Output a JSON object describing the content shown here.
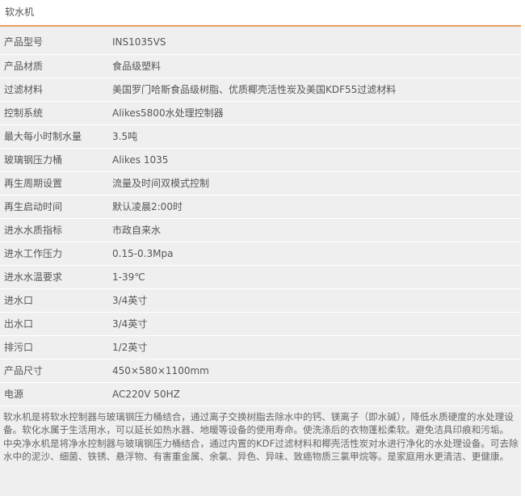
{
  "header": {
    "title": "软水机"
  },
  "specs": [
    {
      "label": "产品型号",
      "value": "INS1035VS"
    },
    {
      "label": "产品材质",
      "value": "食品级塑料"
    },
    {
      "label": "过滤材料",
      "value": "美国罗门哈斯食品级树脂、优质椰壳活性炭及美国KDF55过滤材料"
    },
    {
      "label": "控制系统",
      "value": "Alikes5800水处理控制器"
    },
    {
      "label": "最大每小时制水量",
      "value": "3.5吨"
    },
    {
      "label": "玻璃钢压力桶",
      "value": "Alikes 1035"
    },
    {
      "label": "再生周期设置",
      "value": "流量及时间双模式控制"
    },
    {
      "label": "再生启动时间",
      "value": "默认凌晨2:00时"
    },
    {
      "label": "进水水质指标",
      "value": "市政自来水"
    },
    {
      "label": "进水工作压力",
      "value": "0.15-0.3Mpa"
    },
    {
      "label": "进水水温要求",
      "value": "1-39℃"
    },
    {
      "label": "进水口",
      "value": "3/4英寸"
    },
    {
      "label": "出水口",
      "value": "3/4英寸"
    },
    {
      "label": "排污口",
      "value": "1/2英寸"
    },
    {
      "label": "产品尺寸",
      "value": "450×580×1100mm"
    },
    {
      "label": "电源",
      "value": "AC220V 50HZ"
    }
  ],
  "description": [
    "软水机是将软水控制器与玻璃钢压力桶结合，通过离子交换树脂去除水中的钙、镁离子（即水碱），降低水质硬度的水处理设备。软化水属于生活用水，可以延长如热水器、地暖等设备的使用寿命。使洗涤后的衣物蓬松柔软。避免洁具印痕和污垢。",
    "中央净水机是将净水控制器与玻璃钢压力桶结合，通过内置的KDF过滤材料和椰壳活性炭对水进行净化的水处理设备。可去除水中的泥沙、细菌、铁锈、悬浮物、有害重金属、余氯、异色、异味、致癌物质三氯甲烷等。是家庭用水更清洁、更健康。"
  ]
}
